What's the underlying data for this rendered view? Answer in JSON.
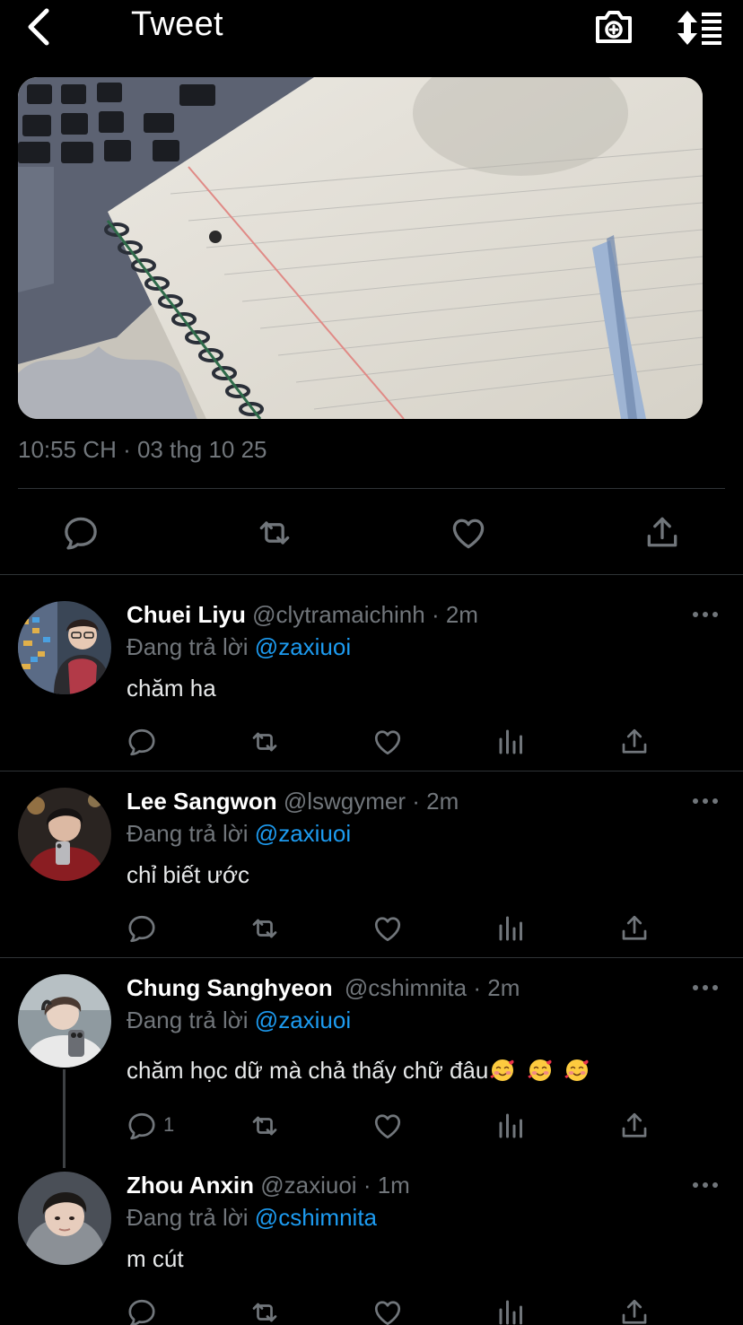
{
  "header": {
    "title": "Tweet",
    "back_icon": "chevron-left-icon",
    "camera_icon": "camera-plus-icon",
    "sort_icon": "sort-icon"
  },
  "tweet": {
    "timestamp": "10:55 CH · 03 thg 10 25",
    "image_icon": "photo-notebook-pen"
  },
  "colors": {
    "background": "#000000",
    "text": "#e7e9ea",
    "secondary": "#71767b",
    "accent": "#1d9bf0",
    "divider": "#2f3336"
  },
  "replies": [
    {
      "name": "Chuei Liyu",
      "handle": "@clytramaichinh",
      "time": "· 2m",
      "replying_label": "Đang trả lời",
      "replying_to": "@zaxiuoi",
      "text": "chăm ha",
      "reply_count": ""
    },
    {
      "name": "Lee Sangwon",
      "handle": "@lswgymer",
      "time": "· 2m",
      "replying_label": "Đang trả lời",
      "replying_to": "@zaxiuoi",
      "text": "chỉ biết ước",
      "reply_count": ""
    },
    {
      "name": "Chung Sanghyeon",
      "handle": "@cshimnita",
      "time": "· 2m",
      "replying_label": "Đang trả lời",
      "replying_to": "@zaxiuoi",
      "text": "chăm học dữ mà chả thấy chữ đâu",
      "reply_count": "1"
    },
    {
      "name": "Zhou Anxin",
      "handle": "@zaxiuoi",
      "time": "· 1m",
      "replying_label": "Đang trả lời",
      "replying_to": "@cshimnita",
      "text": "m cút",
      "reply_count": ""
    }
  ]
}
